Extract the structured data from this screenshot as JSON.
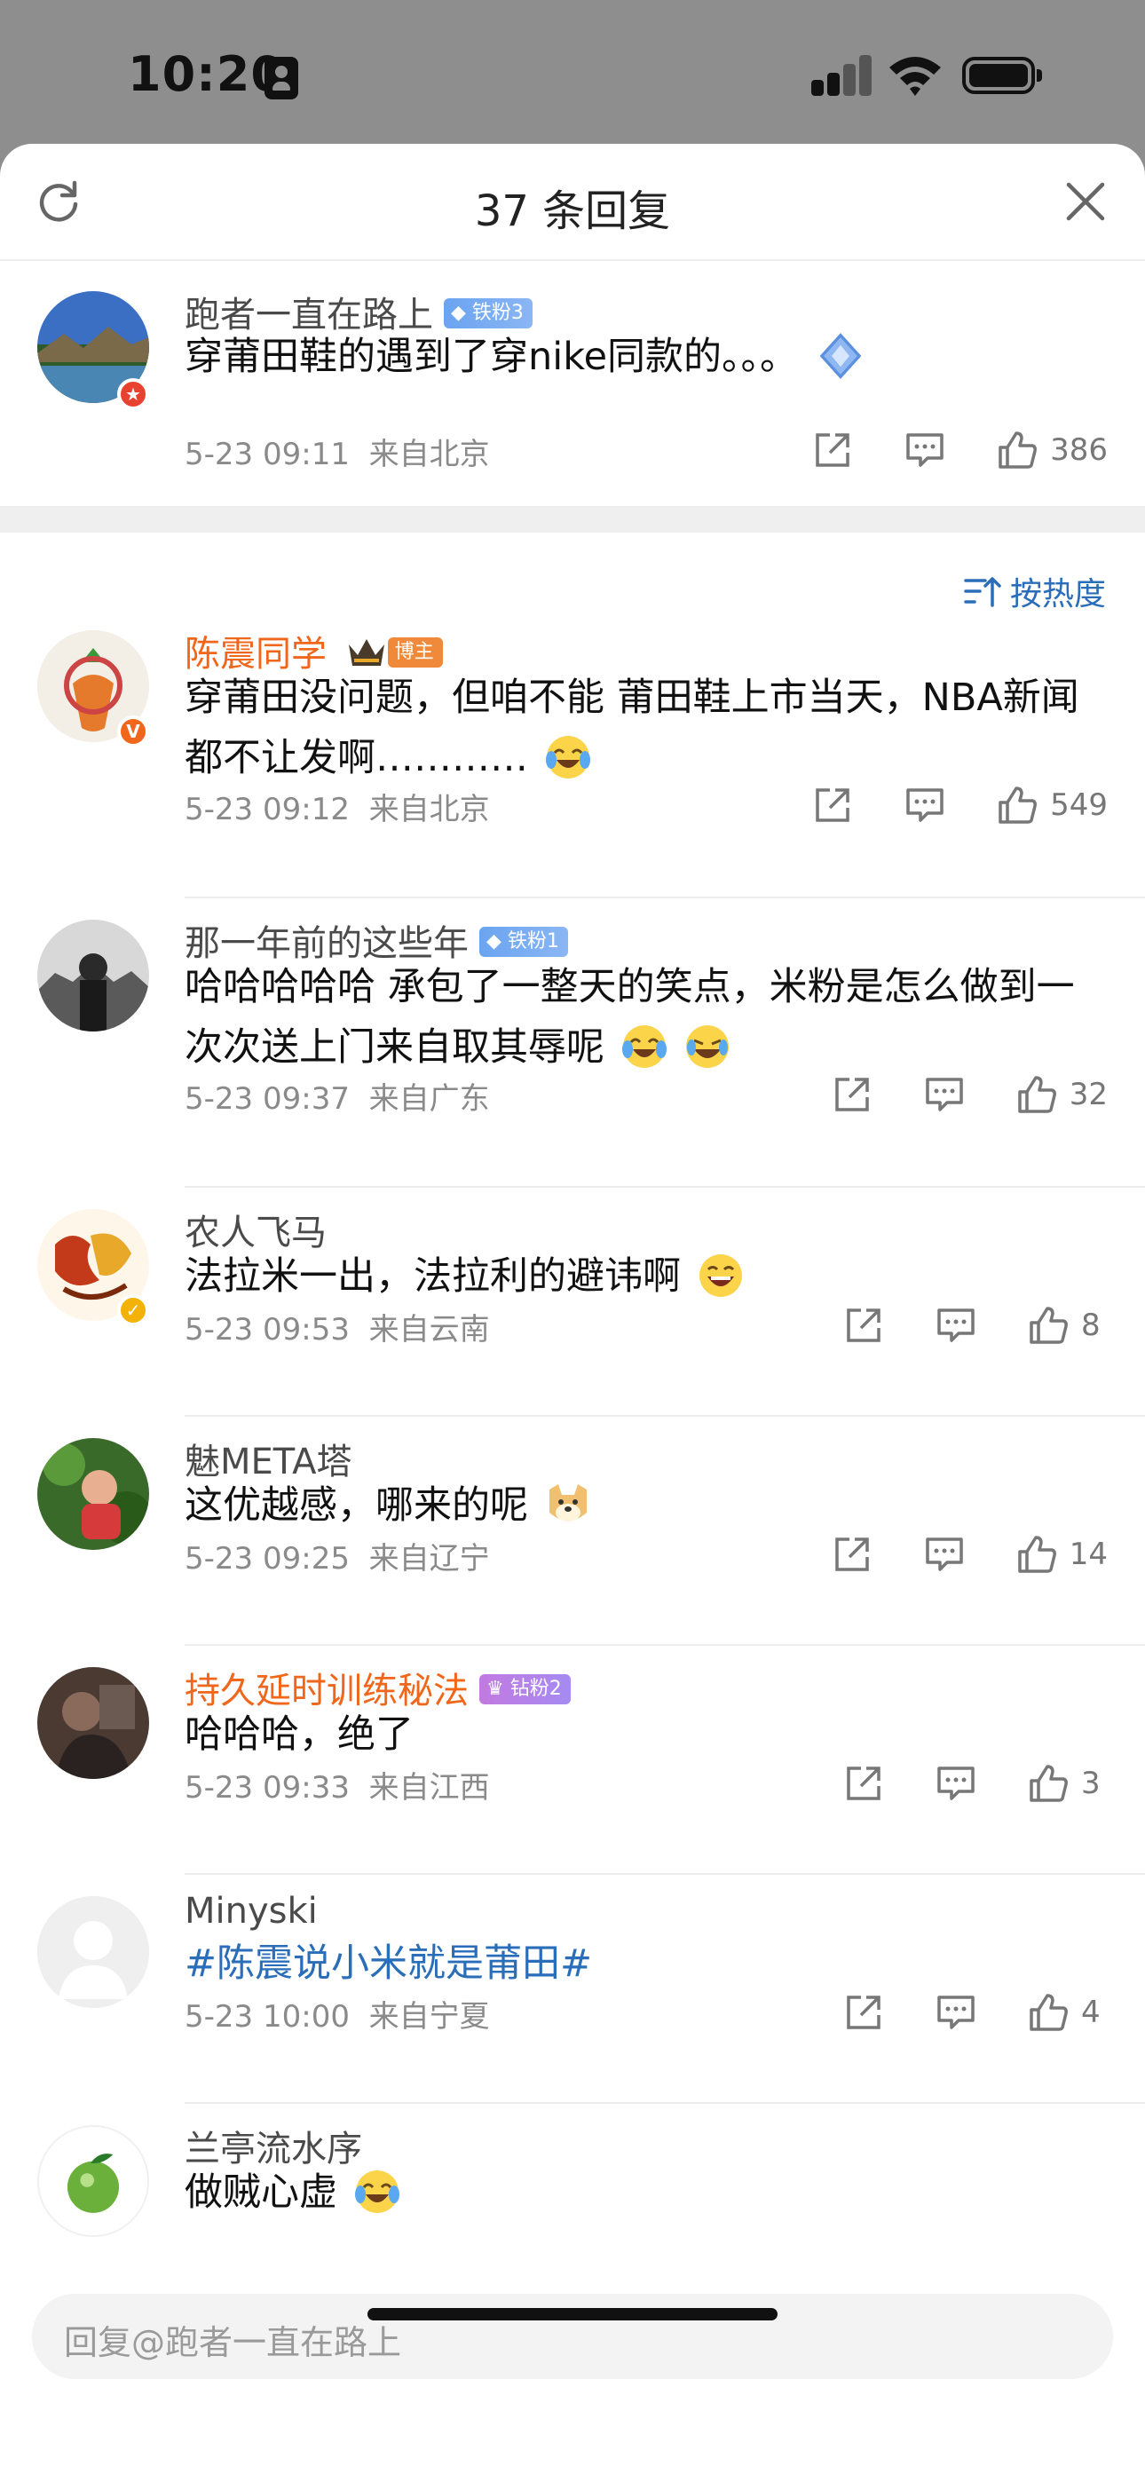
{
  "status_bar": {
    "time": "10:20"
  },
  "sheet": {
    "title": "37 条回复"
  },
  "main_comment": {
    "username": "跑者一直在路上",
    "badge": "铁粉3",
    "text": "穿莆田鞋的遇到了穿nike同款的。。。",
    "time": "5-23 09:11",
    "location": "来自北京",
    "likes": "386"
  },
  "sort": {
    "label": "按热度"
  },
  "replies": [
    {
      "username": "陈震同学",
      "badge": "博主",
      "text": "穿莆田没问题，但咱不能 莆田鞋上市当天，NBA新闻都不让发啊…………",
      "time": "5-23 09:12",
      "location": "来自北京",
      "likes": "549"
    },
    {
      "username": "那一年前的这些年",
      "badge": "铁粉1",
      "text": "哈哈哈哈哈 承包了一整天的笑点，米粉是怎么做到一次次送上门来自取其辱呢",
      "time": "5-23 09:37",
      "location": "来自广东",
      "likes": "32"
    },
    {
      "username": "农人飞马",
      "text": "法拉米一出，法拉利的避讳啊",
      "time": "5-23 09:53",
      "location": "来自云南",
      "likes": "8"
    },
    {
      "username": "魅META塔",
      "text": "这优越感，哪来的呢",
      "time": "5-23 09:25",
      "location": "来自辽宁",
      "likes": "14"
    },
    {
      "username": "持久延时训练秘法",
      "badge": "钻粉2",
      "text": "哈哈哈，绝了",
      "time": "5-23 09:33",
      "location": "来自江西",
      "likes": "3"
    },
    {
      "username": "Minyski",
      "text": "#陈震说小米就是莆田#",
      "time": "5-23 10:00",
      "location": "来自宁夏",
      "likes": "4"
    },
    {
      "username": "兰亭流水序",
      "text": "做贼心虚"
    }
  ],
  "reply_bar": {
    "placeholder": "回复@跑者一直在路上"
  },
  "colors": {
    "link_blue": "#2a6db8",
    "host_orange": "#f0661a",
    "fan_blue": "#6aa4f0",
    "fan_purple": "#c27ae0"
  },
  "icons": [
    "refresh-icon",
    "close-icon",
    "share-icon",
    "comment-icon",
    "like-icon",
    "sort-icon",
    "laugh-cry-emoji",
    "grin-emoji",
    "doge-emoji",
    "diamond-icon",
    "crown-icon",
    "verified-icon"
  ]
}
